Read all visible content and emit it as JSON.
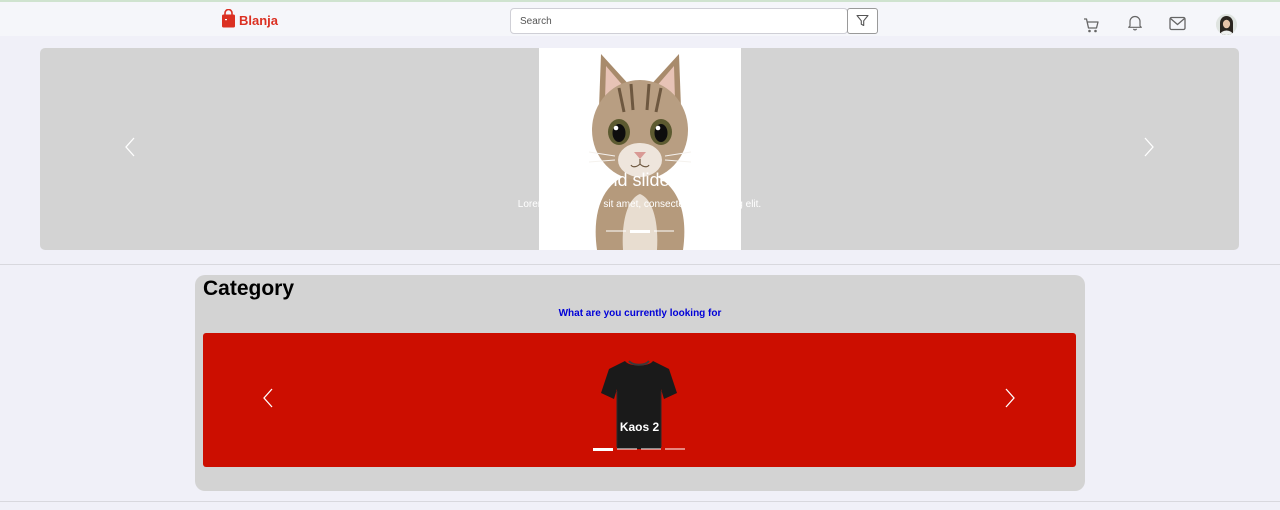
{
  "header": {
    "brand": "Blanja",
    "search": {
      "placeholder": "Search",
      "value": ""
    },
    "icons": [
      "filter-icon",
      "cart-icon",
      "bell-icon",
      "mail-icon",
      "avatar"
    ]
  },
  "hero": {
    "caption_title": "Second slide label",
    "caption_text": "Lorem ipsum dolor sit amet, consectetur adipiscing elit.",
    "active_slide": 2,
    "slide_count": 3
  },
  "category": {
    "title": "Category",
    "subtitle": "What are you currently looking for",
    "product_label": "Kaos 2",
    "active_slide": 1,
    "slide_count": 4
  },
  "colors": {
    "brand": "#db3022",
    "category_carousel": "#cc0e00",
    "subtitle": "#0000d8",
    "panel": "#d3d3d3"
  }
}
